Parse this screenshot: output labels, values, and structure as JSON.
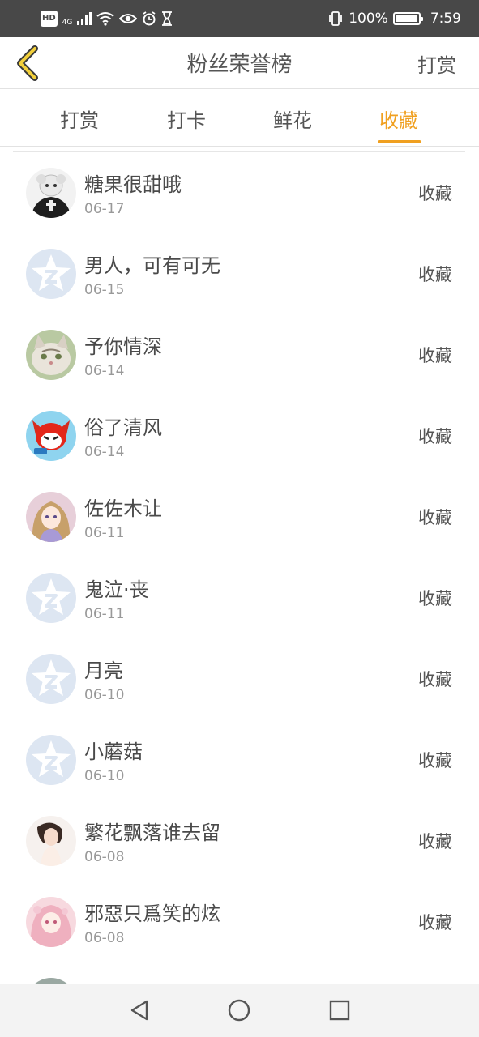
{
  "status_bar": {
    "hd_label": "HD",
    "network_label": "4G",
    "battery_text": "100%",
    "time": "7:59",
    "battery_level": 1.0
  },
  "header": {
    "title": "粉丝荣誉榜",
    "action_label": "打赏",
    "back_icon": "chevron-left-icon"
  },
  "tabs": [
    {
      "label": "打赏",
      "active": false
    },
    {
      "label": "打卡",
      "active": false
    },
    {
      "label": "鲜花",
      "active": false
    },
    {
      "label": "收藏",
      "active": true
    }
  ],
  "colors": {
    "accent": "#f0a020",
    "status_bar_bg": "#484848",
    "divider": "#e6e6e6",
    "default_avatar_bg": "#dde6f2"
  },
  "fans": [
    {
      "name": "糖果很甜哦",
      "date": "06-17",
      "action": "收藏",
      "avatar": "photo-avatar-dark"
    },
    {
      "name": "男人，可有可无",
      "date": "06-15",
      "action": "收藏",
      "avatar": "default-qzone-avatar"
    },
    {
      "name": "予你情深",
      "date": "06-14",
      "action": "收藏",
      "avatar": "photo-avatar-cat"
    },
    {
      "name": "俗了清风",
      "date": "06-14",
      "action": "收藏",
      "avatar": "photo-avatar-cartoon"
    },
    {
      "name": "佐佐木让",
      "date": "06-11",
      "action": "收藏",
      "avatar": "photo-avatar-anime"
    },
    {
      "name": "鬼泣·丧",
      "date": "06-11",
      "action": "收藏",
      "avatar": "default-qzone-avatar"
    },
    {
      "name": "月亮",
      "date": "06-10",
      "action": "收藏",
      "avatar": "default-qzone-avatar"
    },
    {
      "name": "小蘑菇",
      "date": "06-10",
      "action": "收藏",
      "avatar": "default-qzone-avatar"
    },
    {
      "name": "繁花飘落谁去留",
      "date": "06-08",
      "action": "收藏",
      "avatar": "photo-avatar-girl"
    },
    {
      "name": "邪惡只爲笑的炫",
      "date": "06-08",
      "action": "收藏",
      "avatar": "photo-avatar-pink"
    },
    {
      "name": "",
      "date": "",
      "action": "",
      "avatar": "photo-avatar-partial"
    }
  ],
  "nav_bar": {
    "back_icon": "triangle-back-icon",
    "home_icon": "circle-home-icon",
    "recents_icon": "square-recents-icon"
  }
}
